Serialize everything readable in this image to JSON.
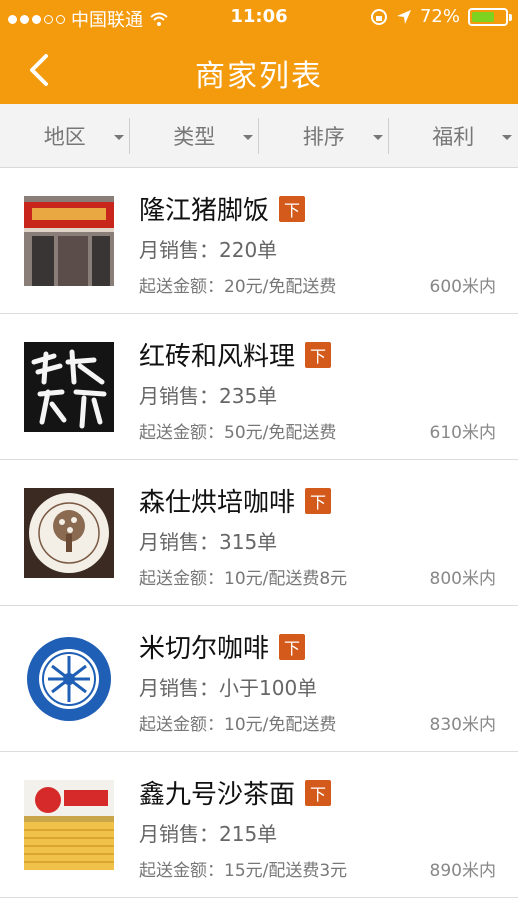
{
  "status_bar": {
    "carrier": "中国联通",
    "time": "11:06",
    "battery": "72%",
    "battery_level": 0.72,
    "signal_bars": 3,
    "signal_total": 5
  },
  "nav": {
    "title": "商家列表",
    "back_icon": "chevron-left-icon"
  },
  "filters": [
    {
      "label": "地区"
    },
    {
      "label": "类型"
    },
    {
      "label": "排序"
    },
    {
      "label": "福利"
    }
  ],
  "merchants": [
    {
      "name": "隆江猪脚饭",
      "tag": "下",
      "sales": "月销售：220单",
      "min_fee": "起送金额：20元/免配送费",
      "distance": "600米内"
    },
    {
      "name": "红砖和风料理",
      "tag": "下",
      "sales": "月销售：235单",
      "min_fee": "起送金额：50元/免配送费",
      "distance": "610米内"
    },
    {
      "name": "森仕烘培咖啡",
      "tag": "下",
      "sales": "月销售：315单",
      "min_fee": "起送金额：10元/配送费8元",
      "distance": "800米内"
    },
    {
      "name": "米切尔咖啡",
      "tag": "下",
      "sales": "月销售：小于100单",
      "min_fee": "起送金额：10元/免配送费",
      "distance": "830米内"
    },
    {
      "name": "鑫九号沙茶面",
      "tag": "下",
      "sales": "月销售：215单",
      "min_fee": "起送金额：15元/配送费3元",
      "distance": "890米内"
    }
  ],
  "colors": {
    "accent": "#f49a0d",
    "tag": "#d45a1b",
    "battery": "#7ed321"
  }
}
